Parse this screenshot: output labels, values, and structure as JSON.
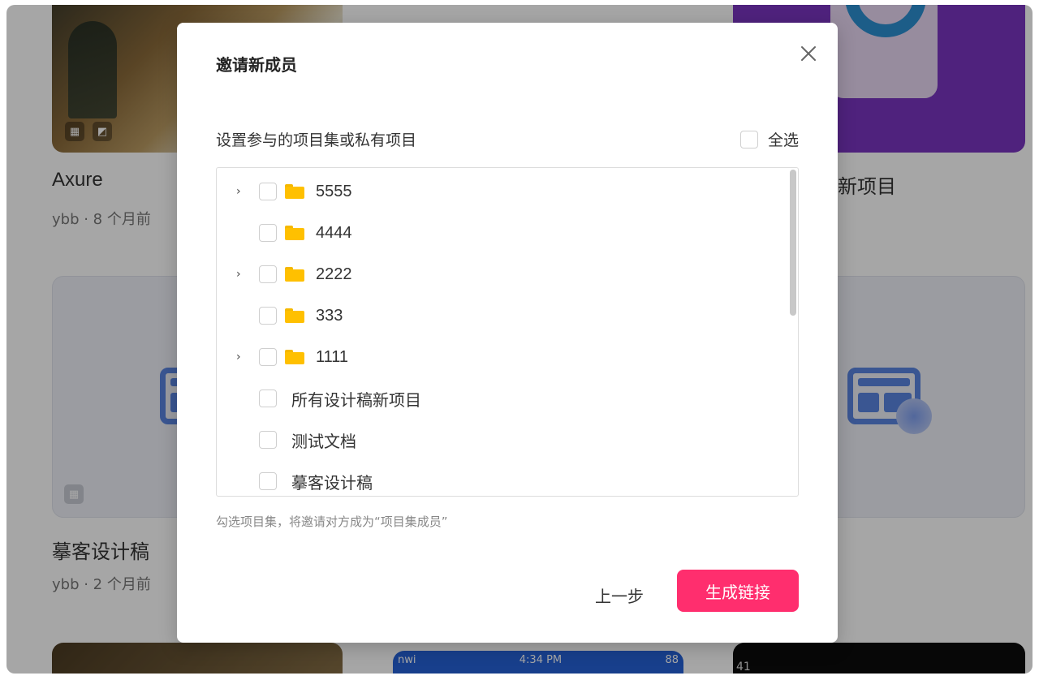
{
  "background": {
    "cards": [
      {
        "title": "Axure",
        "meta": "ybb · 8 个月前"
      },
      {
        "title_partial": "新项目"
      },
      {
        "title": "摹客设计稿",
        "meta": "ybb · 2 个月前"
      }
    ],
    "phone_status": {
      "carrier": "nwi",
      "time": "4:34 PM",
      "battery": "88"
    },
    "bottom_right_text": "41"
  },
  "modal": {
    "title": "邀请新成员",
    "section_label": "设置参与的项目集或私有项目",
    "select_all_label": "全选",
    "items": [
      {
        "label": "5555",
        "type": "folder",
        "expandable": true
      },
      {
        "label": "4444",
        "type": "folder",
        "expandable": false
      },
      {
        "label": "2222",
        "type": "folder",
        "expandable": true
      },
      {
        "label": "333",
        "type": "folder",
        "expandable": false
      },
      {
        "label": "1111",
        "type": "folder",
        "expandable": true
      },
      {
        "label": "所有设计稿新项目",
        "type": "project",
        "expandable": false
      },
      {
        "label": "测试文档",
        "type": "project",
        "expandable": false
      },
      {
        "label": "摹客设计稿",
        "type": "project",
        "expandable": false
      }
    ],
    "hint": "勾选项目集，将邀请对方成为“项目集成员”",
    "prev_button": "上一步",
    "generate_button": "生成链接"
  },
  "colors": {
    "primary_button": "#ff2e6e",
    "folder": "#ffc000",
    "overlay": "rgba(0,0,0,0.35)"
  },
  "icons": [
    "close-icon",
    "chevron-right-icon",
    "folder-icon",
    "layout-icon",
    "image-icon"
  ]
}
